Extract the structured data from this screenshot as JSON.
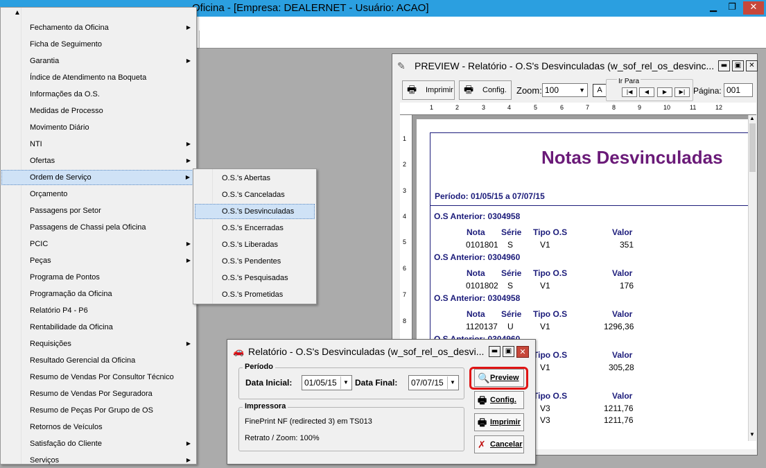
{
  "main_window": {
    "title": "Oficina - [Empresa: DEALERNET - Usuário: ACAO]",
    "controls": {
      "minimize": "▁",
      "restore": "❐",
      "close": "✕"
    }
  },
  "menu": {
    "scroll_up_glyph": "▲",
    "submenu_glyph": "▶",
    "items": [
      {
        "label": "Fechamento da Oficina",
        "has_submenu": true
      },
      {
        "label": "Ficha de Seguimento",
        "has_submenu": false
      },
      {
        "label": "Garantia",
        "has_submenu": true
      },
      {
        "label": "Índice de Atendimento na Boqueta",
        "has_submenu": false
      },
      {
        "label": "Informações da O.S.",
        "has_submenu": false
      },
      {
        "label": "Medidas de Processo",
        "has_submenu": false
      },
      {
        "label": "Movimento Diário",
        "has_submenu": false
      },
      {
        "label": "NTI",
        "has_submenu": true
      },
      {
        "label": "Ofertas",
        "has_submenu": true
      },
      {
        "label": "Ordem de Serviço",
        "has_submenu": true,
        "highlighted": true
      },
      {
        "label": "Orçamento",
        "has_submenu": false
      },
      {
        "label": "Passagens por Setor",
        "has_submenu": false
      },
      {
        "label": "Passagens de Chassi pela Oficina",
        "has_submenu": false
      },
      {
        "label": "PCIC",
        "has_submenu": true
      },
      {
        "label": "Peças",
        "has_submenu": true
      },
      {
        "label": "Programa de Pontos",
        "has_submenu": false
      },
      {
        "label": "Programação da Oficina",
        "has_submenu": false
      },
      {
        "label": "Relatório P4 - P6",
        "has_submenu": false
      },
      {
        "label": "Rentabilidade da Oficina",
        "has_submenu": false
      },
      {
        "label": "Requisições",
        "has_submenu": true
      },
      {
        "label": "Resultado Gerencial da Oficina",
        "has_submenu": false
      },
      {
        "label": "Resumo de Vendas Por Consultor Técnico",
        "has_submenu": false
      },
      {
        "label": "Resumo de Vendas Por Seguradora",
        "has_submenu": false
      },
      {
        "label": "Resumo de Peças Por Grupo de OS",
        "has_submenu": false
      },
      {
        "label": "Retornos de Veículos",
        "has_submenu": false
      },
      {
        "label": "Satisfação do Cliente",
        "has_submenu": true
      },
      {
        "label": "Serviços",
        "has_submenu": true
      }
    ]
  },
  "submenu": {
    "items": [
      {
        "label": "O.S.'s Abertas"
      },
      {
        "label": "O.S.'s Canceladas"
      },
      {
        "label": "O.S.'s Desvinculadas",
        "highlighted": true
      },
      {
        "label": "O.S.'s Encerradas"
      },
      {
        "label": "O.S.'s Liberadas"
      },
      {
        "label": "O.S.'s Pendentes"
      },
      {
        "label": "O.S.'s Pesquisadas"
      },
      {
        "label": "O.S.'s Prometidas"
      }
    ]
  },
  "preview": {
    "title": "PREVIEW - Relatório - O.S's Desvinculadas (w_sof_rel_os_desvinc...",
    "controls": {
      "minimize": "▬",
      "restore": "▣",
      "close": "✕"
    },
    "toolbar": {
      "print_label": "Imprimir",
      "config_label": "Config.",
      "zoom_label": "Zoom:",
      "zoom_value": "100",
      "fit_glyph": "A",
      "goto_label": "Ir Para",
      "nav_first": "|◀",
      "nav_prev": "◀",
      "nav_next": "▶",
      "nav_last": "▶|",
      "page_label": "Página:",
      "page_value": "001"
    },
    "ruler_top": [
      "1",
      "2",
      "3",
      "4",
      "5",
      "6",
      "7",
      "8",
      "9",
      "10",
      "11",
      "12"
    ],
    "ruler_left": [
      "1",
      "2",
      "3",
      "4",
      "5",
      "6",
      "7",
      "8"
    ],
    "report": {
      "title": "Notas Desvinculadas",
      "period": "Período: 01/05/15  a 07/07/15",
      "col_headers": {
        "nota": "Nota",
        "serie": "Série",
        "tipo": "Tipo O.S",
        "valor": "Valor"
      },
      "groups": [
        {
          "os": "O.S Anterior: 0304958",
          "nota": "0101801",
          "serie": "S",
          "tipo": "V1",
          "valor": "351"
        },
        {
          "os": "O.S Anterior: 0304960",
          "nota": "0101802",
          "serie": "S",
          "tipo": "V1",
          "valor": "176"
        },
        {
          "os": "O.S Anterior: 0304958",
          "nota": "1120137",
          "serie": "U",
          "tipo": "V1",
          "valor": "1296,36"
        }
      ],
      "partial_os": "O.S Anterior: 0304960",
      "hidden_rows": [
        {
          "tipo_hdr": "Tipo O.S",
          "valor_hdr": "Valor",
          "tipo": "V1",
          "valor": "305,28"
        },
        {
          "tipo_hdr": "Tipo O.S",
          "valor_hdr": "Valor",
          "tipo": "V3",
          "valor": "1211,76"
        }
      ],
      "extra_row": {
        "tipo": "V3",
        "valor": "1211,76"
      }
    }
  },
  "dialog": {
    "title": "Relatório - O.S's Desvinculadas (w_sof_rel_os_desvi...",
    "controls": {
      "minimize": "▬",
      "restore": "▣",
      "close": "✕"
    },
    "periodo_label": "Período",
    "data_inicial_label": "Data Inicial:",
    "data_inicial_value": "01/05/15",
    "data_final_label": "Data Final:",
    "data_final_value": "07/07/15",
    "impressora_label": "Impressora",
    "printer_name": "FinePrint NF (redirected 3) em TS013",
    "printer_zoom": "Retrato / Zoom: 100%",
    "buttons": {
      "preview": "Preview",
      "config": "Config.",
      "imprimir": "Imprimir",
      "cancelar": "Cancelar"
    },
    "dropdown_glyph": "▼"
  },
  "colors": {
    "titlebar": "#2b9fe0",
    "report_title": "#6a1a78",
    "report_header": "#1b1b7a",
    "highlight_ring": "#e01414",
    "menu_highlight": "#cfe2f6"
  }
}
